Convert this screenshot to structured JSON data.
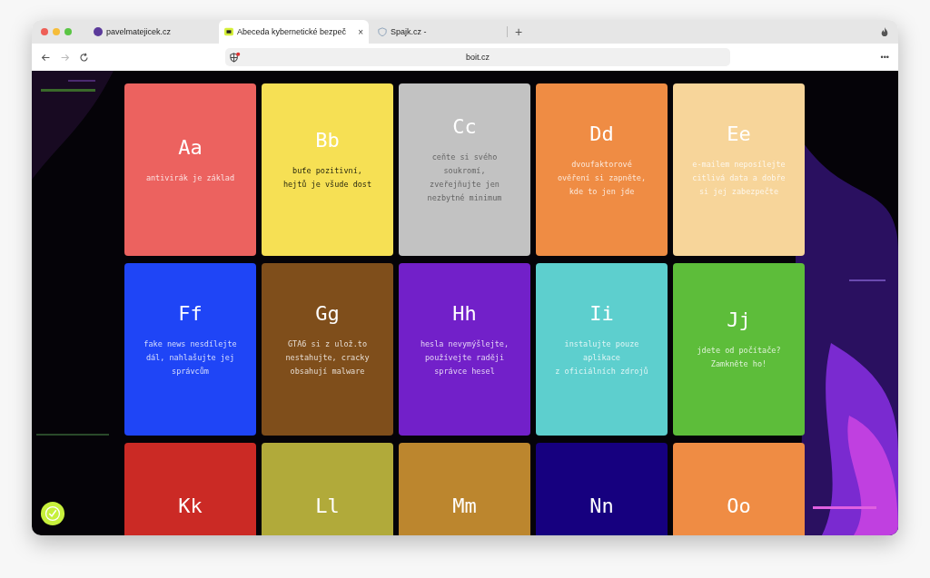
{
  "tabs": [
    {
      "label": "pavelmatejicek.cz",
      "selected": false,
      "kind": "site"
    },
    {
      "label": "Abeceda kybernetické bezpeč",
      "selected": true,
      "kind": "page",
      "close": "×"
    },
    {
      "label": "Spajk.cz -",
      "selected": false,
      "kind": "shield"
    }
  ],
  "new_tab": "+",
  "toolbar": {
    "url": "boit.cz",
    "menu": "•••",
    "forward_disabled": true
  },
  "cards": [
    {
      "letter": "Aa",
      "text": "antivirák je základ",
      "color": "#ec625f",
      "kind": "light"
    },
    {
      "letter": "Bb",
      "text": "buťe pozitivní,\nhejtů je všude dost",
      "color": "#f6e054",
      "kind": "dark"
    },
    {
      "letter": "Cc",
      "text": "ceňte si svého\nsoukromí,\nzveřejňujte jen\nnezbytné minimum",
      "color": "#c2c2c2",
      "kind": "faint"
    },
    {
      "letter": "Dd",
      "text": "dvoufaktorové\nověření si zapněte,\nkde to jen jde",
      "color": "#ef8c44",
      "kind": "light"
    },
    {
      "letter": "Ee",
      "text": "e-mailem neposílejte\ncitlivá data a dobře\nsi jej zabezpečte",
      "color": "#f7d59a",
      "kind": "light"
    },
    {
      "letter": "Ff",
      "text": "fake news nesdílejte\ndál, nahlašujte jej\nsprávcům",
      "color": "#1f45f6",
      "kind": "light"
    },
    {
      "letter": "Gg",
      "text": "GTA6 si z ulož.to\nnestahujte, cracky\nobsahují malware",
      "color": "#7f4e1b",
      "kind": "light"
    },
    {
      "letter": "Hh",
      "text": "hesla nevymýšlejte,\npoužívejte raději\nsprávce hesel",
      "color": "#7220c9",
      "kind": "light"
    },
    {
      "letter": "Ii",
      "text": "instalujte pouze\naplikace\nz oficiálních zdrojů",
      "color": "#5dcfce",
      "kind": "light"
    },
    {
      "letter": "Jj",
      "text": "jdete od počítače?\nZamkněte ho!",
      "color": "#5dbd3a",
      "kind": "light"
    },
    {
      "letter": "Kk",
      "color": "#cb2a25"
    },
    {
      "letter": "Ll",
      "color": "#b1aa3a"
    },
    {
      "letter": "Mm",
      "color": "#bc862e"
    },
    {
      "letter": "Nn",
      "color": "#16007f"
    },
    {
      "letter": "Oo",
      "color": "#ef8c44"
    }
  ]
}
